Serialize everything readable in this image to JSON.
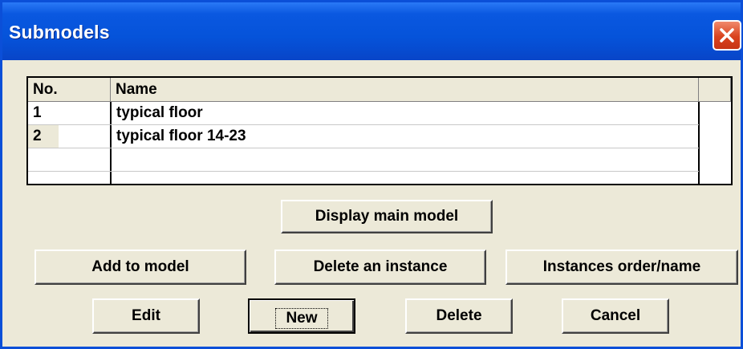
{
  "window": {
    "title": "Submodels"
  },
  "table": {
    "columns": [
      "No.",
      "Name"
    ],
    "rows": [
      {
        "no": "1",
        "name": "typical floor"
      },
      {
        "no": "2",
        "name": "typical floor 14-23"
      },
      {
        "no": "",
        "name": ""
      },
      {
        "no": "",
        "name": ""
      }
    ]
  },
  "buttons": {
    "display_main_model": "Display main model",
    "add_to_model": "Add to model",
    "delete_instance": "Delete an instance",
    "instances_order": "Instances order/name",
    "edit": "Edit",
    "new": "New",
    "delete": "Delete",
    "cancel": "Cancel"
  },
  "colors": {
    "titlebar": "#0553da",
    "dialog_bg": "#ece9d8",
    "close_button": "#d9431e"
  },
  "icons": {
    "close": "close-icon"
  }
}
